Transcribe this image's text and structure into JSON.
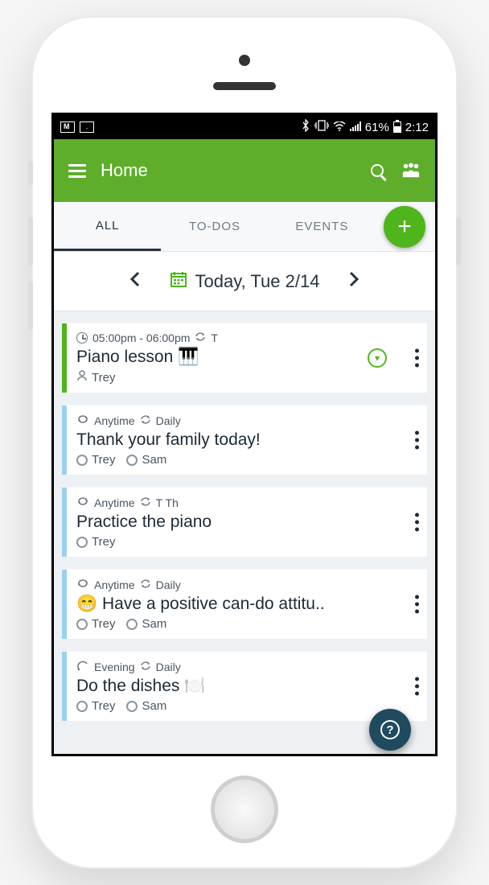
{
  "statusbar": {
    "battery": "61%",
    "time": "2:12"
  },
  "header": {
    "title": "Home"
  },
  "tabs": {
    "items": [
      {
        "label": "ALL",
        "active": true
      },
      {
        "label": "TO-DOS",
        "active": false
      },
      {
        "label": "EVENTS",
        "active": false
      }
    ]
  },
  "datebar": {
    "label": "Today, Tue 2/14"
  },
  "items": [
    {
      "stripe": "green",
      "time": "05:00pm - 06:00pm",
      "repeat": "T",
      "meta_icon": "clock",
      "title": "Piano lesson 🎹",
      "assignees": [
        {
          "name": "Trey",
          "marker": "person"
        }
      ],
      "has_checkcircle": true
    },
    {
      "stripe": "blue",
      "time": "Anytime",
      "repeat": "Daily",
      "meta_icon": "loop",
      "title": "Thank your family today!",
      "assignees": [
        {
          "name": "Trey",
          "marker": "circle"
        },
        {
          "name": "Sam",
          "marker": "circle"
        }
      ],
      "has_checkcircle": false
    },
    {
      "stripe": "blue",
      "time": "Anytime",
      "repeat": "T Th",
      "meta_icon": "loop",
      "title": "Practice the piano",
      "assignees": [
        {
          "name": "Trey",
          "marker": "circle"
        }
      ],
      "has_checkcircle": false
    },
    {
      "stripe": "blue",
      "time": "Anytime",
      "repeat": "Daily",
      "meta_icon": "loop",
      "title": "😁 Have a positive can-do attitu..",
      "assignees": [
        {
          "name": "Trey",
          "marker": "circle"
        },
        {
          "name": "Sam",
          "marker": "circle"
        }
      ],
      "has_checkcircle": false
    },
    {
      "stripe": "blue",
      "time": "Evening",
      "repeat": "Daily",
      "meta_icon": "evening",
      "title": "Do the dishes 🍽️",
      "assignees": [
        {
          "name": "Trey",
          "marker": "circle"
        },
        {
          "name": "Sam",
          "marker": "circle"
        }
      ],
      "has_checkcircle": false
    }
  ]
}
